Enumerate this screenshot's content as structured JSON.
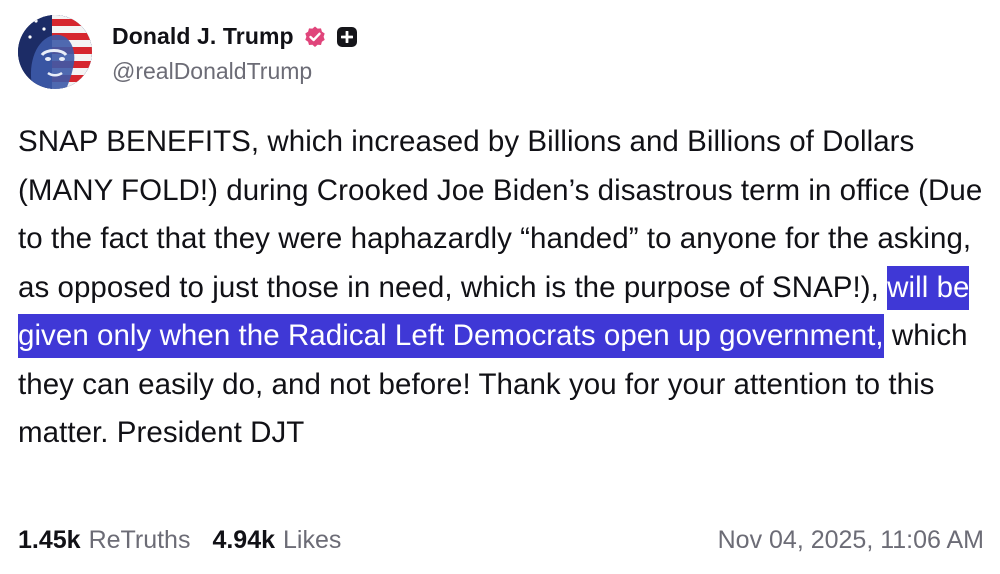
{
  "author": {
    "display_name": "Donald J. Trump",
    "handle": "@realDonaldTrump",
    "avatar_icon": "flag-portrait-avatar",
    "verified_icon": "verified-badge-icon",
    "verified_color": "#e0457b",
    "plus_icon": "plus-badge-icon"
  },
  "post": {
    "text_before": "SNAP BENEFITS, which increased by Billions and Billions of Dollars (MANY FOLD!) during Crooked Joe Biden’s disastrous term in office (Due to the fact that they were haphazardly “handed” to anyone for the asking, as opposed to just those in need, which is the purpose of SNAP!), ",
    "highlighted": "will be given only when the Radical Left Democrats open up government,",
    "text_after": " which they can easily do, and not before! Thank you for your attention to this matter. President DJT",
    "highlight_color": "#3f38d6"
  },
  "stats": {
    "retruths_count": "1.45k",
    "retruths_label": "ReTruths",
    "likes_count": "4.94k",
    "likes_label": "Likes"
  },
  "timestamp": "Nov 04, 2025, 11:06 AM"
}
